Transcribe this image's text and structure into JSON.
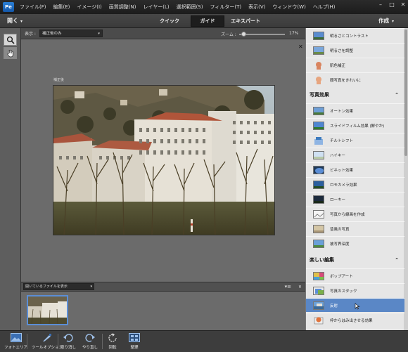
{
  "menubar": {
    "app_icon": "Pe",
    "items": [
      "ファイル(F)",
      "編集(E)",
      "イメージ(I)",
      "画質調整(N)",
      "レイヤー(L)",
      "選択範囲(S)",
      "フィルター(T)",
      "表示(V)",
      "ウィンドウ(W)",
      "ヘルプ(H)"
    ],
    "window_controls": [
      "–",
      "□",
      "✕"
    ]
  },
  "modebar": {
    "open_label": "開く",
    "modes": [
      "クイック",
      "ガイド",
      "エキスパート"
    ],
    "active_mode": "ガイド",
    "create_label": "作成"
  },
  "tool_options": {
    "view_label": "表示 :",
    "view_value": "補正後のみ",
    "zoom_label": "ズーム :",
    "zoom_value": "17%",
    "zoom_fraction": 0.05
  },
  "canvas": {
    "photo_title": "補正後"
  },
  "photo_bin": {
    "select_value": "開いているファイルを表示",
    "menu_icon": "menu-icon",
    "collapse_icon": "chevron-down-icon"
  },
  "panel": {
    "top_items": [
      {
        "label": "明るさとコントラスト"
      },
      {
        "label": "明るさを調整"
      },
      {
        "label": "肌色補正"
      },
      {
        "label": "顔写真をきれいに"
      }
    ],
    "sections": [
      {
        "title": "写真効果",
        "items": [
          {
            "label": "オートン効果"
          },
          {
            "label": "スライドフィルム効果 (鮮やか)"
          },
          {
            "label": "チルトシフト"
          },
          {
            "label": "ハイキー"
          },
          {
            "label": "ビネット効果"
          },
          {
            "label": "ロモカメラ効果"
          },
          {
            "label": "ローキー"
          },
          {
            "label": "写真から線画を作成"
          },
          {
            "label": "昔風の写真"
          },
          {
            "label": "被写界深度"
          }
        ]
      },
      {
        "title": "楽しい編集",
        "items": [
          {
            "label": "ポップアート"
          },
          {
            "label": "写真のスタック"
          },
          {
            "label": "反射",
            "selected": true
          },
          {
            "label": "枠からはみ出させる効果"
          }
        ]
      }
    ]
  },
  "bottom_bar": {
    "buttons": [
      {
        "label": "フォトエリア",
        "icon": "photo-bin-icon"
      },
      {
        "label": "ツールオプション",
        "icon": "tool-options-icon"
      },
      {
        "label": "取り消し",
        "icon": "undo-icon"
      },
      {
        "label": "やり直し",
        "icon": "redo-icon"
      },
      {
        "label": "回転",
        "icon": "rotate-icon"
      },
      {
        "label": "整理",
        "icon": "organize-icon"
      }
    ]
  },
  "colors": {
    "accent_selected": "#5a87c6",
    "menubar_bg": "#1c1c1c",
    "panel_bg": "#e6e6e6"
  }
}
